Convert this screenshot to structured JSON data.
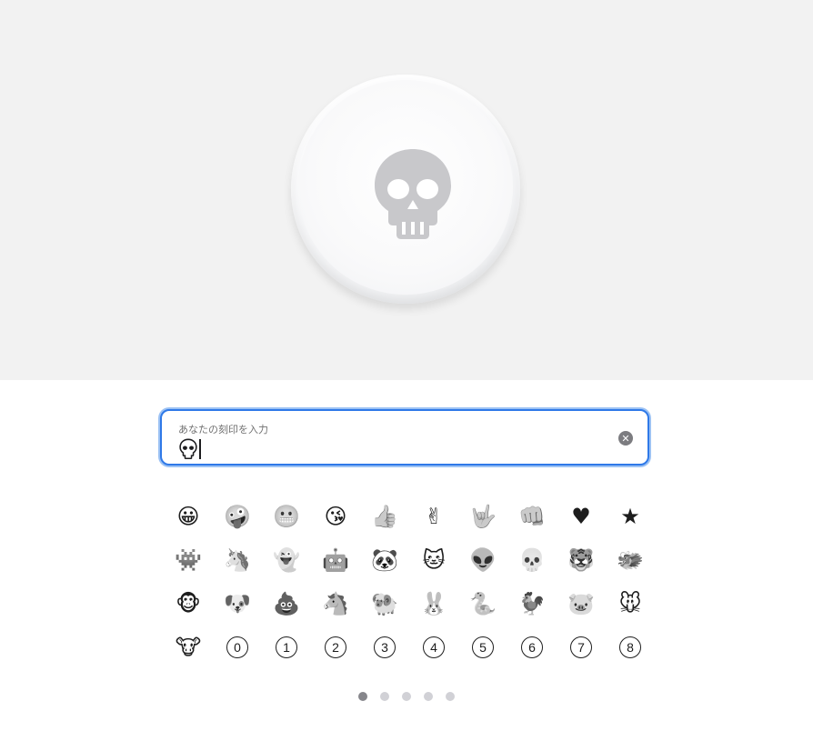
{
  "engraving": {
    "current": "💀",
    "label": "あなたの刻印を入力"
  },
  "field": {
    "label": "あなたの刻印を入力",
    "clear_icon": "clear-icon"
  },
  "emoji_grid": [
    {
      "name": "grinning-face-icon",
      "glyph": "😀"
    },
    {
      "name": "zany-face-icon",
      "glyph": "🤪"
    },
    {
      "name": "grimacing-face-icon",
      "glyph": "😬"
    },
    {
      "name": "face-blowing-kiss-icon",
      "glyph": "😘"
    },
    {
      "name": "thumbs-up-icon",
      "glyph": "👍"
    },
    {
      "name": "victory-hand-icon",
      "glyph": "✌"
    },
    {
      "name": "love-you-gesture-icon",
      "glyph": "🤟"
    },
    {
      "name": "oncoming-fist-icon",
      "glyph": "👊"
    },
    {
      "name": "heart-icon",
      "glyph": "♥"
    },
    {
      "name": "star-icon",
      "glyph": "★"
    },
    {
      "name": "alien-monster-icon",
      "glyph": "👾"
    },
    {
      "name": "unicorn-icon",
      "glyph": "🦄"
    },
    {
      "name": "ghost-icon",
      "glyph": "👻"
    },
    {
      "name": "robot-icon",
      "glyph": "🤖"
    },
    {
      "name": "panda-icon",
      "glyph": "🐼"
    },
    {
      "name": "cat-icon",
      "glyph": "🐱"
    },
    {
      "name": "alien-icon",
      "glyph": "👽"
    },
    {
      "name": "skull-icon",
      "glyph": "💀"
    },
    {
      "name": "tiger-icon",
      "glyph": "🐯"
    },
    {
      "name": "dragon-icon",
      "glyph": "🐲"
    },
    {
      "name": "monkey-icon",
      "glyph": "🐵"
    },
    {
      "name": "dog-icon",
      "glyph": "🐶"
    },
    {
      "name": "pile-of-poo-icon",
      "glyph": "💩"
    },
    {
      "name": "horse-icon",
      "glyph": "🐴"
    },
    {
      "name": "ram-icon",
      "glyph": "🐏"
    },
    {
      "name": "rabbit-icon",
      "glyph": "🐰"
    },
    {
      "name": "snake-icon",
      "glyph": "🐍"
    },
    {
      "name": "rooster-icon",
      "glyph": "🐓"
    },
    {
      "name": "pig-icon",
      "glyph": "🐷"
    },
    {
      "name": "mouse-icon",
      "glyph": "🐭"
    },
    {
      "name": "cow-icon",
      "glyph": "🐮"
    }
  ],
  "number_buttons": [
    "0",
    "1",
    "2",
    "3",
    "4",
    "5",
    "6",
    "7",
    "8"
  ],
  "pagination": {
    "pages": 5,
    "current": 1
  },
  "colors": {
    "focus_border": "#2f79e8",
    "preview_bg": "#f2f2f2",
    "engraving": "#c9c9cc"
  }
}
